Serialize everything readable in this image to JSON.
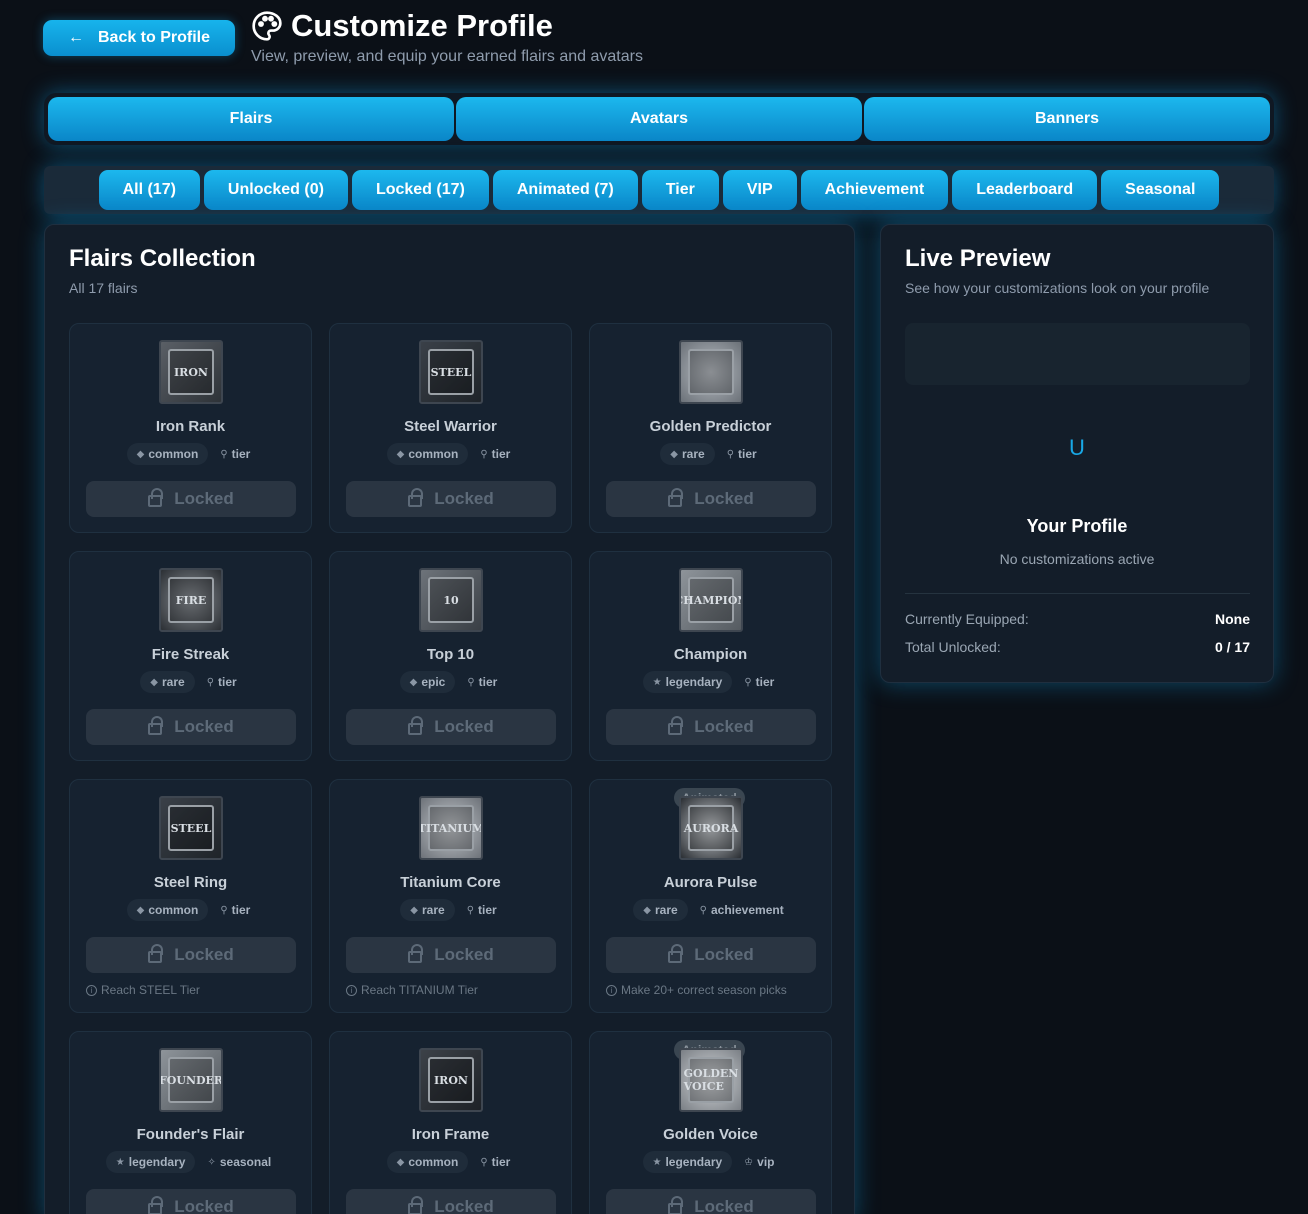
{
  "header": {
    "back_label": "Back to Profile",
    "title": "Customize Profile",
    "subtitle": "View, preview, and equip your earned flairs and avatars"
  },
  "main_tabs": [
    "Flairs",
    "Avatars",
    "Banners"
  ],
  "filters": [
    "All (17)",
    "Unlocked (0)",
    "Locked (17)",
    "Animated (7)",
    "Tier",
    "VIP",
    "Achievement",
    "Leaderboard",
    "Seasonal"
  ],
  "collection": {
    "title": "Flairs Collection",
    "subtitle": "All 17 flairs",
    "locked_label": "Locked",
    "animated_label": "Animated",
    "cards": [
      {
        "name": "Iron Rank",
        "rarity": "common",
        "category": "tier",
        "thumb_text": "IRON",
        "requirement": ""
      },
      {
        "name": "Steel Warrior",
        "rarity": "common",
        "category": "tier",
        "thumb_text": "STEEL",
        "requirement": ""
      },
      {
        "name": "Golden Predictor",
        "rarity": "rare",
        "category": "tier",
        "thumb_text": "",
        "requirement": ""
      },
      {
        "name": "Fire Streak",
        "rarity": "rare",
        "category": "tier",
        "thumb_text": "FIRE",
        "requirement": ""
      },
      {
        "name": "Top 10",
        "rarity": "epic",
        "category": "tier",
        "thumb_text": "10",
        "requirement": ""
      },
      {
        "name": "Champion",
        "rarity": "legendary",
        "category": "tier",
        "thumb_text": "CHAMPION",
        "requirement": ""
      },
      {
        "name": "Steel Ring",
        "rarity": "common",
        "category": "tier",
        "thumb_text": "STEEL",
        "requirement": "Reach STEEL Tier"
      },
      {
        "name": "Titanium Core",
        "rarity": "rare",
        "category": "tier",
        "thumb_text": "TITANIUM",
        "requirement": "Reach TITANIUM Tier"
      },
      {
        "name": "Aurora Pulse",
        "rarity": "rare",
        "category": "achievement",
        "thumb_text": "AURORA",
        "requirement": "Make 20+ correct season picks"
      },
      {
        "name": "Founder's Flair",
        "rarity": "legendary",
        "category": "seasonal",
        "thumb_text": "FOUNDER",
        "requirement": ""
      },
      {
        "name": "Iron Frame",
        "rarity": "common",
        "category": "tier",
        "thumb_text": "IRON",
        "requirement": ""
      },
      {
        "name": "Golden Voice",
        "rarity": "legendary",
        "category": "vip",
        "thumb_text": "GOLDEN VOICE",
        "requirement": ""
      }
    ]
  },
  "preview": {
    "title": "Live Preview",
    "subtitle": "See how your customizations look on your profile",
    "avatar_letter": "U",
    "name": "Your Profile",
    "status": "No customizations active",
    "equipped_label": "Currently Equipped:",
    "equipped_value": "None",
    "unlocked_label": "Total Unlocked:",
    "unlocked_value": "0 / 17"
  },
  "colors": {
    "accent": "#14a9e6",
    "background": "#0b1017",
    "panel": "#131d29"
  }
}
